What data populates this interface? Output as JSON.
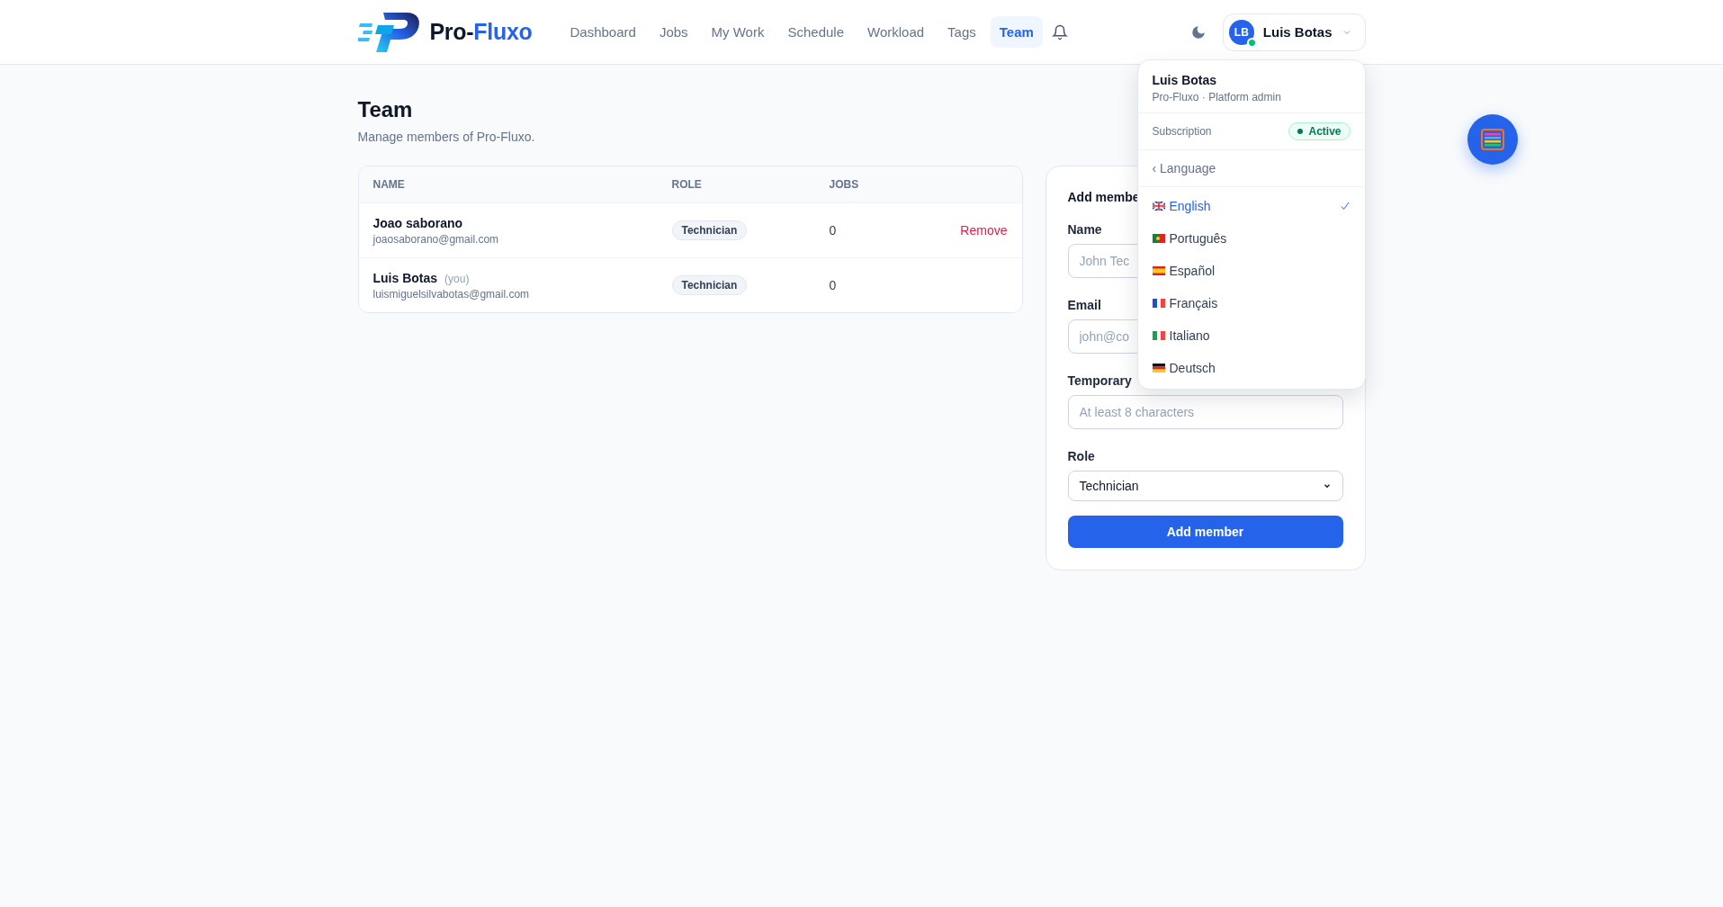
{
  "brand": {
    "prefix": "Pro-",
    "highlight": "Fluxo"
  },
  "nav": [
    {
      "label": "Dashboard",
      "selected": false
    },
    {
      "label": "Jobs",
      "selected": false
    },
    {
      "label": "My Work",
      "selected": false
    },
    {
      "label": "Schedule",
      "selected": false
    },
    {
      "label": "Workload",
      "selected": false
    },
    {
      "label": "Tags",
      "selected": false
    },
    {
      "label": "Team",
      "selected": true
    }
  ],
  "user_menu": {
    "initials": "LB",
    "name": "Luis Botas",
    "online": true,
    "expanded": true
  },
  "dropdown": {
    "name": "Luis Botas",
    "subtitle": "Pro-Fluxo · Platform admin",
    "subscription_label": "Subscription",
    "subscription_status": "Active",
    "back_label": "‹ Language",
    "languages": [
      {
        "label": "English",
        "selected": true
      },
      {
        "label": "Português",
        "selected": false
      },
      {
        "label": "Español",
        "selected": false
      },
      {
        "label": "Français",
        "selected": false
      },
      {
        "label": "Italiano",
        "selected": false
      },
      {
        "label": "Deutsch",
        "selected": false
      }
    ]
  },
  "page": {
    "title": "Team",
    "subtitle": "Manage members of Pro-Fluxo."
  },
  "table": {
    "columns": [
      "NAME",
      "ROLE",
      "JOBS"
    ],
    "rows": [
      {
        "name": "Joao saborano",
        "tag": null,
        "email": "joaosaborano@gmail.com",
        "role": "Technician",
        "jobs": "0",
        "action": "Remove"
      },
      {
        "name": "Luis Botas",
        "tag": "(you)",
        "email": "luismiguelsilvabotas@gmail.com",
        "role": "Technician",
        "jobs": "0",
        "action": null
      }
    ]
  },
  "form": {
    "title": "Add membe",
    "fields": [
      {
        "kind": "text",
        "label": "Name",
        "placeholder": "John Tec"
      },
      {
        "kind": "text",
        "label": "Email",
        "placeholder": "john@co"
      },
      {
        "kind": "text",
        "label": "Temporary",
        "placeholder": "At least 8 characters"
      },
      {
        "kind": "select",
        "label": "Role",
        "value": "Technician"
      }
    ],
    "submit": "Add member"
  }
}
